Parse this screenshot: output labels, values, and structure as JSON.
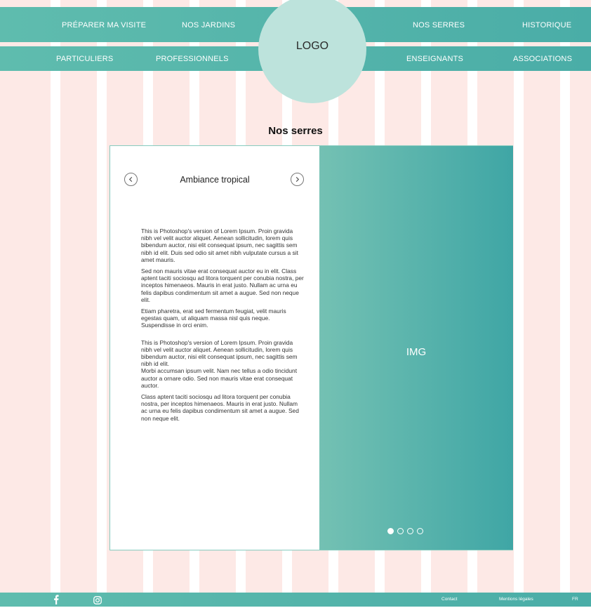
{
  "nav_top": {
    "items": [
      "PRÉPARER MA VISITE",
      "NOS JARDINS",
      "NOS SERRES",
      "HISTORIQUE"
    ]
  },
  "nav_sub": {
    "items": [
      "PARTICULIERS",
      "PROFESSIONNELS",
      "ENSEIGNANTS",
      "ASSOCIATIONS"
    ]
  },
  "logo": "LOGO",
  "page_title": "Nos serres",
  "slider": {
    "title": "Ambiance tropical",
    "image_label": "IMG",
    "dots_total": 4,
    "dot_active_index": 0
  },
  "content": {
    "paragraphs": [
      "This is Photoshop's version of Lorem Ipsum. Proin gravida nibh vel velit auctor aliquet. Aenean sollicitudin, lorem quis bibendum auctor, nisi elit consequat ipsum, nec sagittis sem nibh id elit. Duis sed odio sit amet nibh vulputate cursus a sit amet mauris.",
      "Sed non  mauris vitae erat consequat auctor eu in elit. Class aptent taciti sociosqu ad litora torquent per conubia nostra, per inceptos himenaeos. Mauris in erat justo. Nullam ac urna eu felis dapibus condimentum sit amet a augue. Sed non neque elit.",
      " Etiam pharetra, erat sed fermentum feugiat, velit mauris egestas quam, ut aliquam massa nisl quis neque. Suspendisse in orci enim.",
      "This is Photoshop's version  of Lorem Ipsum. Proin gravida nibh vel velit auctor aliquet. Aenean sollicitudin, lorem quis bibendum auctor, nisi elit consequat ipsum, nec sagittis sem nibh id elit.",
      "Morbi accumsan ipsum velit. Nam nec tellus a odio tincidunt auctor a ornare odio. Sed non mauris vitae erat consequat auctor.",
      "Class aptent taciti sociosqu ad litora torquent per conubia nostra, per inceptos himenaeos. Mauris in erat justo. Nullam ac urna eu felis dapibus condimentum sit amet a augue. Sed non neque elit."
    ]
  },
  "footer": {
    "social_icons": [
      "facebook-icon",
      "instagram-icon"
    ],
    "links": [
      "Contact",
      "Mentions légales",
      "FR"
    ]
  },
  "colors": {
    "teal_light": "#5fbcae",
    "teal_dark": "#4aada7",
    "logo_bg": "#bde3dc",
    "stripe_pink": "#fde9e6"
  }
}
